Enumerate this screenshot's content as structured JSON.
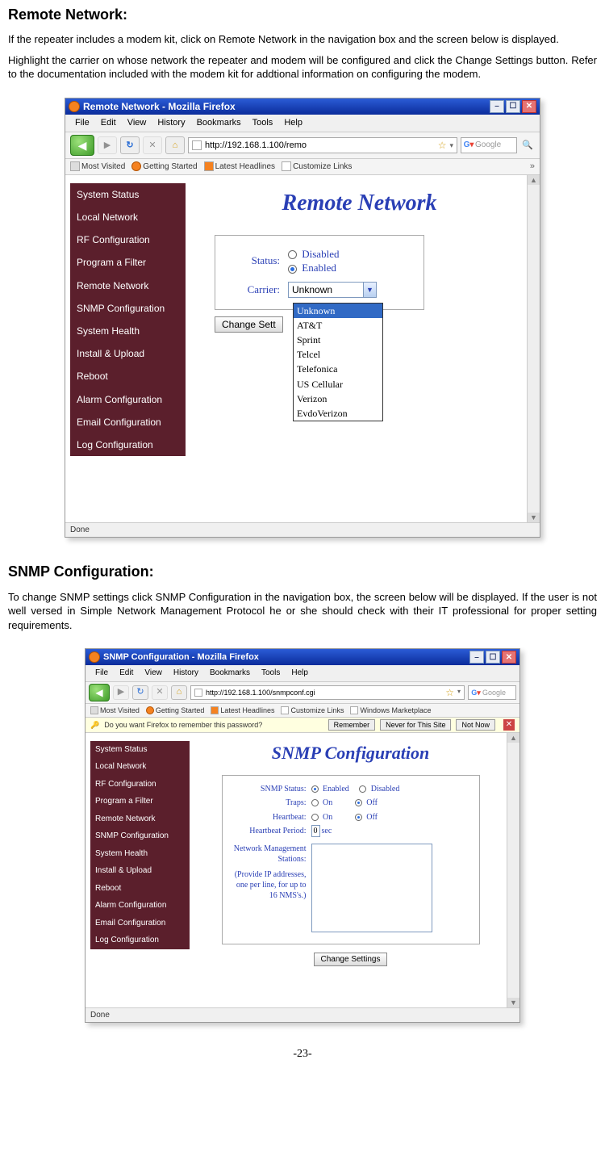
{
  "page_number": "-23-",
  "section1": {
    "heading": "Remote Network:",
    "para1": "If the repeater includes a modem kit, click on Remote Network in the navigation box and the screen below is displayed.",
    "para2": "Highlight the carrier on whose network the repeater and modem will be configured and click the Change Settings button. Refer to the documentation included with the modem kit for addtional information on configuring the modem."
  },
  "section2": {
    "heading": "SNMP Configuration:",
    "para1": "To change SNMP settings click SNMP Configuration in the navigation box, the screen below will be displayed. If the user is not well versed in Simple Network Management Protocol he or she should check with their IT professional for proper setting requirements."
  },
  "fig1": {
    "window_title": "Remote Network - Mozilla Firefox",
    "menus": {
      "file": "File",
      "edit": "Edit",
      "view": "View",
      "history": "History",
      "bookmarks": "Bookmarks",
      "tools": "Tools",
      "help": "Help"
    },
    "url": "http://192.168.1.100/remo",
    "search_placeholder": "Google",
    "bookmarks": {
      "mv": "Most Visited",
      "gs": "Getting Started",
      "lh": "Latest Headlines",
      "cl": "Customize Links"
    },
    "nav": [
      "System Status",
      "Local Network",
      "RF Configuration",
      "Program a Filter",
      "Remote Network",
      "SNMP Configuration",
      "System Health",
      "Install & Upload",
      "Reboot",
      "Alarm Configuration",
      "Email Configuration",
      "Log Configuration"
    ],
    "page_title": "Remote Network",
    "status_label": "Status:",
    "status_disabled": "Disabled",
    "status_enabled": "Enabled",
    "carrier_label": "Carrier:",
    "carrier_selected": "Unknown",
    "carrier_options": [
      "Unknown",
      "AT&T",
      "Sprint",
      "Telcel",
      "Telefonica",
      "US Cellular",
      "Verizon",
      "EvdoVerizon"
    ],
    "change_btn": "Change Sett",
    "status_bar": "Done"
  },
  "fig2": {
    "window_title": "SNMP Configuration - Mozilla Firefox",
    "menus": {
      "file": "File",
      "edit": "Edit",
      "view": "View",
      "history": "History",
      "bookmarks": "Bookmarks",
      "tools": "Tools",
      "help": "Help"
    },
    "url": "http://192.168.1.100/snmpconf.cgi",
    "search_placeholder": "Google",
    "bookmarks": {
      "mv": "Most Visited",
      "gs": "Getting Started",
      "lh": "Latest Headlines",
      "cl": "Customize Links",
      "wm": "Windows Marketplace"
    },
    "pw_prompt": "Do you want Firefox to remember this password?",
    "pw_remember": "Remember",
    "pw_never": "Never for This Site",
    "pw_notnow": "Not Now",
    "nav": [
      "System Status",
      "Local Network",
      "RF Configuration",
      "Program a Filter",
      "Remote Network",
      "SNMP Configuration",
      "System Health",
      "Install & Upload",
      "Reboot",
      "Alarm Configuration",
      "Email Configuration",
      "Log Configuration"
    ],
    "page_title": "SNMP Configuration",
    "snmp_status_label": "SNMP Status:",
    "enabled": "Enabled",
    "disabled": "Disabled",
    "traps_label": "Traps:",
    "on": "On",
    "off": "Off",
    "heartbeat_label": "Heartbeat:",
    "heartbeat_period_label": "Heartbeat Period:",
    "heartbeat_value": "0",
    "sec": "sec",
    "nms_label": "Network Management Stations:",
    "nms_hint": "(Provide IP addresses, one per line, for up to 16 NMS's.)",
    "change_btn": "Change Settings",
    "status_bar": "Done"
  }
}
